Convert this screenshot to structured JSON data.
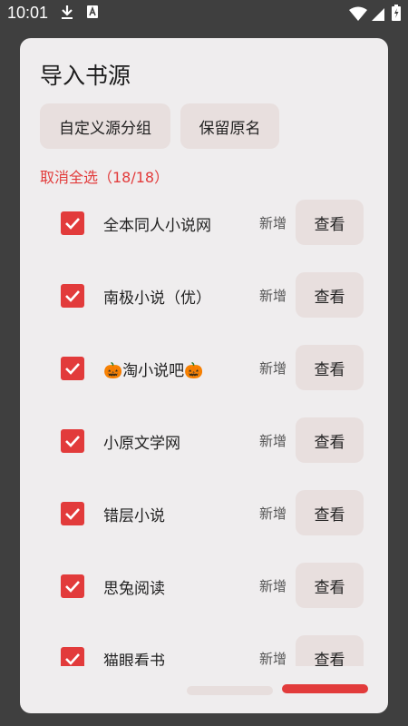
{
  "status": {
    "time": "10:01"
  },
  "dialog": {
    "title": "导入书源",
    "group_button": "自定义源分组",
    "keep_name_button": "保留原名",
    "select_all": "取消全选（18/18）",
    "items": [
      {
        "name": "全本同人小说网",
        "tag": "新增",
        "action": "查看"
      },
      {
        "name": "南极小说（优）",
        "tag": "新增",
        "action": "查看"
      },
      {
        "name": "🎃淘小说吧🎃",
        "tag": "新增",
        "action": "查看"
      },
      {
        "name": "小原文学网",
        "tag": "新增",
        "action": "查看"
      },
      {
        "name": "错层小说",
        "tag": "新增",
        "action": "查看"
      },
      {
        "name": "思兔阅读",
        "tag": "新增",
        "action": "查看"
      },
      {
        "name": "猫眼看书",
        "tag": "新增",
        "action": "查看"
      }
    ]
  },
  "colors": {
    "accent": "#e23b3b",
    "button_bg": "#e8dfde",
    "dialog_bg": "#efedee"
  }
}
